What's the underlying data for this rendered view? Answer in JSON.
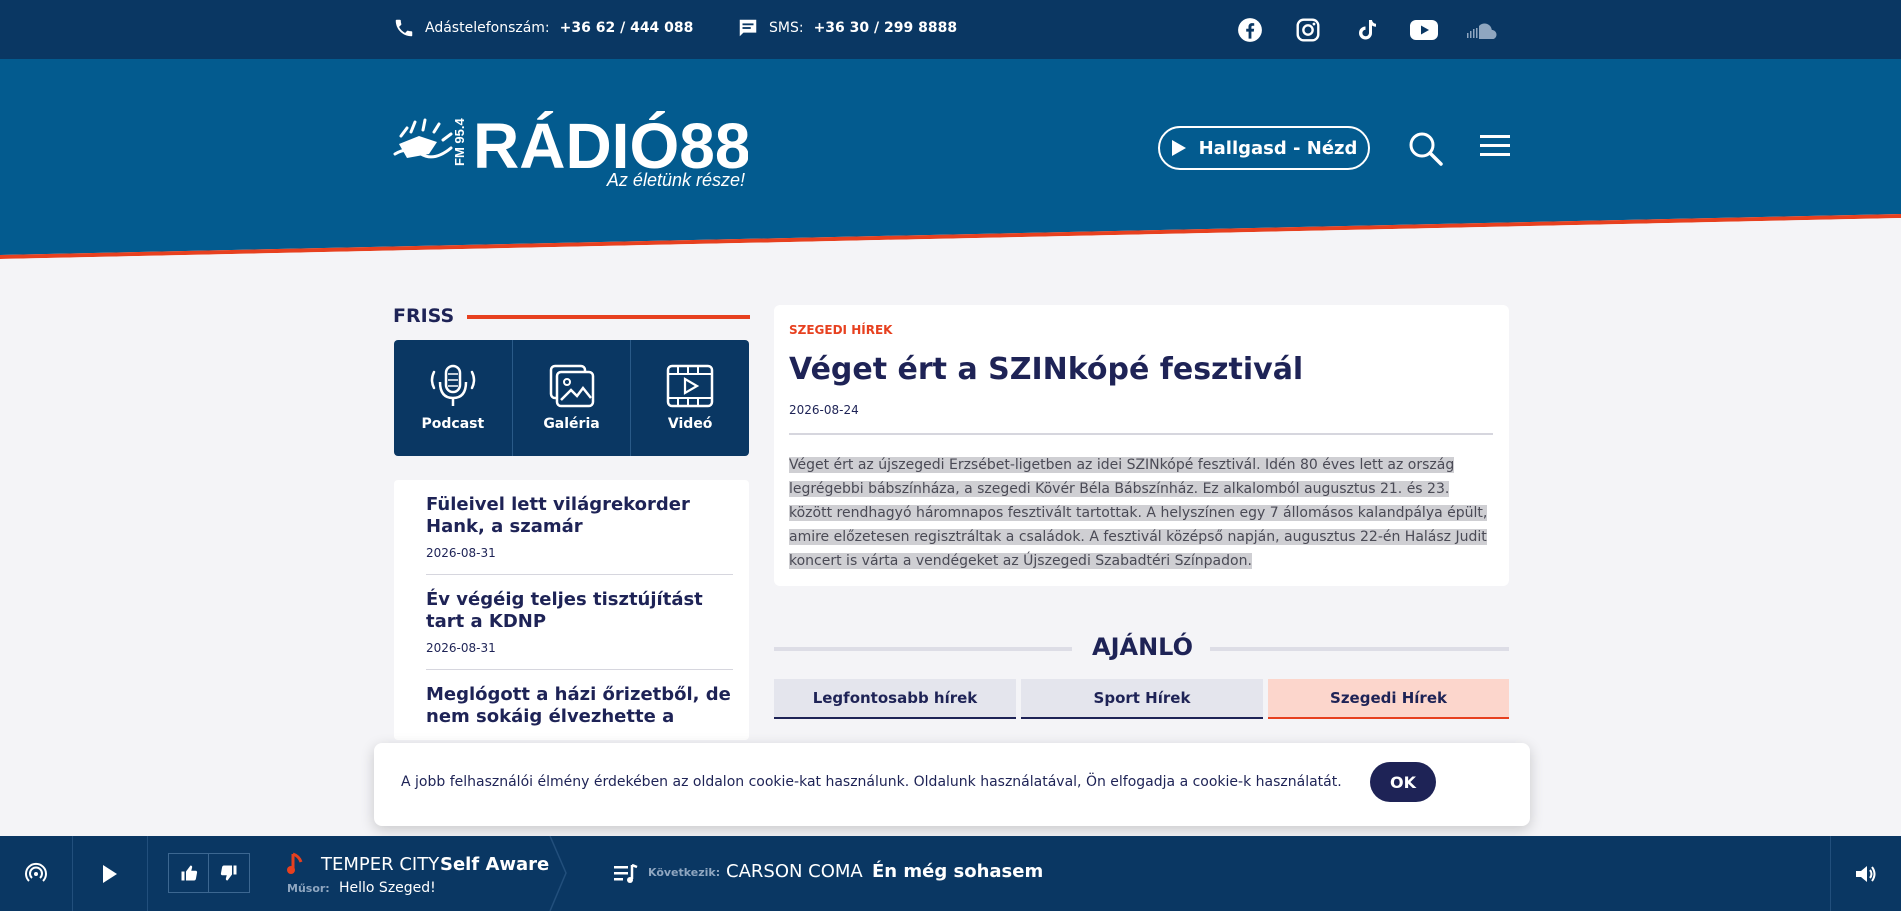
{
  "topbar": {
    "phone_label": "Adástelefonszám:",
    "phone_value": "+36 62 / 444 088",
    "sms_label": "SMS:",
    "sms_value": "+36 30 / 299 8888",
    "socials": [
      "facebook-icon",
      "instagram-icon",
      "tiktok-icon",
      "youtube-icon",
      "soundcloud-icon"
    ]
  },
  "header": {
    "logo_name": "RÁDIÓ88",
    "logo_fm": "FM 95.4",
    "logo_slogan": "Az életünk része!",
    "listen_label": "Hallgasd - Nézd"
  },
  "friss": {
    "title": "FRISS",
    "media": [
      {
        "label": "Podcast",
        "icon": "microphone-icon"
      },
      {
        "label": "Galéria",
        "icon": "gallery-icon"
      },
      {
        "label": "Videó",
        "icon": "video-icon"
      }
    ],
    "news": [
      {
        "title": "Füleivel lett világrekorder Hank, a szamár",
        "date": "2026-08-31"
      },
      {
        "title": "Év végéig teljes tisztújítást tart a KDNP",
        "date": "2026-08-31"
      },
      {
        "title": "Meglógott a házi őrizetből, de nem sokáig élvezhette a",
        "date": ""
      }
    ]
  },
  "article": {
    "category": "SZEGEDI HÍREK",
    "title": "Véget ért a SZINkópé fesztivál",
    "date": "2026-08-24",
    "body": "Véget ért az újszegedi Erzsébet-ligetben az idei SZINkópé fesztivál. Idén 80 éves lett az ország legrégebbi bábszínháza, a szegedi Kövér Béla Bábszínház. Ez alkalomból augusztus 21. és 23. között rendhagyó háromnapos fesztivált tartottak. A helyszínen egy 7 állomásos kalandpálya épült, amire előzetesen regisztráltak a családok. A fesztivál középső napján, augusztus 22-én Halász Judit koncert is várta a vendégeket az Újszegedi Szabadtéri Színpadon."
  },
  "ajanlo": {
    "title": "AJÁNLÓ",
    "tabs": [
      {
        "label": "Legfontosabb hírek",
        "active": false
      },
      {
        "label": "Sport Hírek",
        "active": false
      },
      {
        "label": "Szegedi Hírek",
        "active": true
      }
    ]
  },
  "cookie": {
    "text": "A jobb felhasználói élmény érdekében az oldalon cookie-kat használunk. Oldalunk használatával, Ön elfogadja a cookie-k használatát.",
    "ok_label": "OK"
  },
  "player": {
    "now_artist": "TEMPER CITY",
    "now_title": "Self Aware",
    "show_label": "Műsor:",
    "show_value": "Hello Szeged!",
    "next_label": "Következik:",
    "next_artist": "CARSON COMA",
    "next_title": "Én még sohasem"
  },
  "colors": {
    "navy": "#0a3763",
    "header_blue": "#035b8f",
    "accent_red": "#e7401f",
    "text_dark": "#1e2356"
  }
}
